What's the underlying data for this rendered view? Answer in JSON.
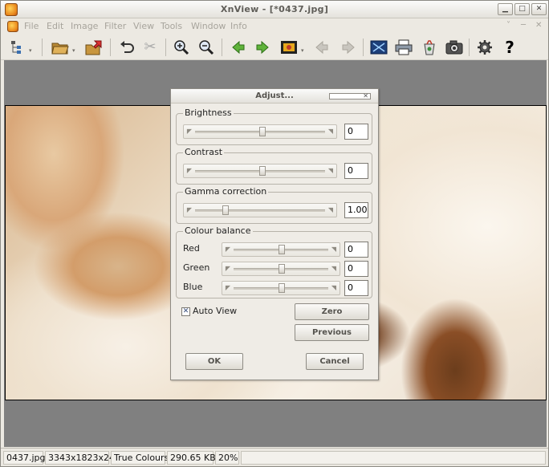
{
  "window": {
    "title": "XnView - [*0437.jpg]"
  },
  "menu": {
    "items": [
      "File",
      "Edit",
      "Image",
      "Filter",
      "View",
      "Tools",
      "Window",
      "Info"
    ]
  },
  "toolbar": {
    "icons": [
      "browser-tree-icon",
      "open-folder-icon",
      "export-icon",
      "undo-icon",
      "cut-icon",
      "zoom-in-icon",
      "zoom-out-icon",
      "previous-arrow-icon",
      "next-arrow-icon",
      "slideshow-icon",
      "first-page-icon",
      "last-page-icon",
      "fullscreen-icon",
      "print-icon",
      "recycle-icon",
      "capture-icon",
      "settings-gear-icon",
      "help-icon"
    ]
  },
  "dialog": {
    "title": "Adjust...",
    "brightness": {
      "label": "Brightness",
      "value": "0"
    },
    "contrast": {
      "label": "Contrast",
      "value": "0"
    },
    "gamma": {
      "label": "Gamma correction",
      "value": "1.00"
    },
    "colour_balance": {
      "label": "Colour balance",
      "red": {
        "label": "Red",
        "value": "0"
      },
      "green": {
        "label": "Green",
        "value": "0"
      },
      "blue": {
        "label": "Blue",
        "value": "0"
      }
    },
    "auto_view": {
      "label": "Auto View",
      "checked": true
    },
    "buttons": {
      "zero": "Zero",
      "previous": "Previous",
      "ok": "OK",
      "cancel": "Cancel"
    }
  },
  "status": {
    "filename": "0437.jpg",
    "dimensions": "3343x1823x24",
    "colour_mode": "True Colours",
    "filesize": "290.65 KB",
    "zoom": "20%"
  }
}
